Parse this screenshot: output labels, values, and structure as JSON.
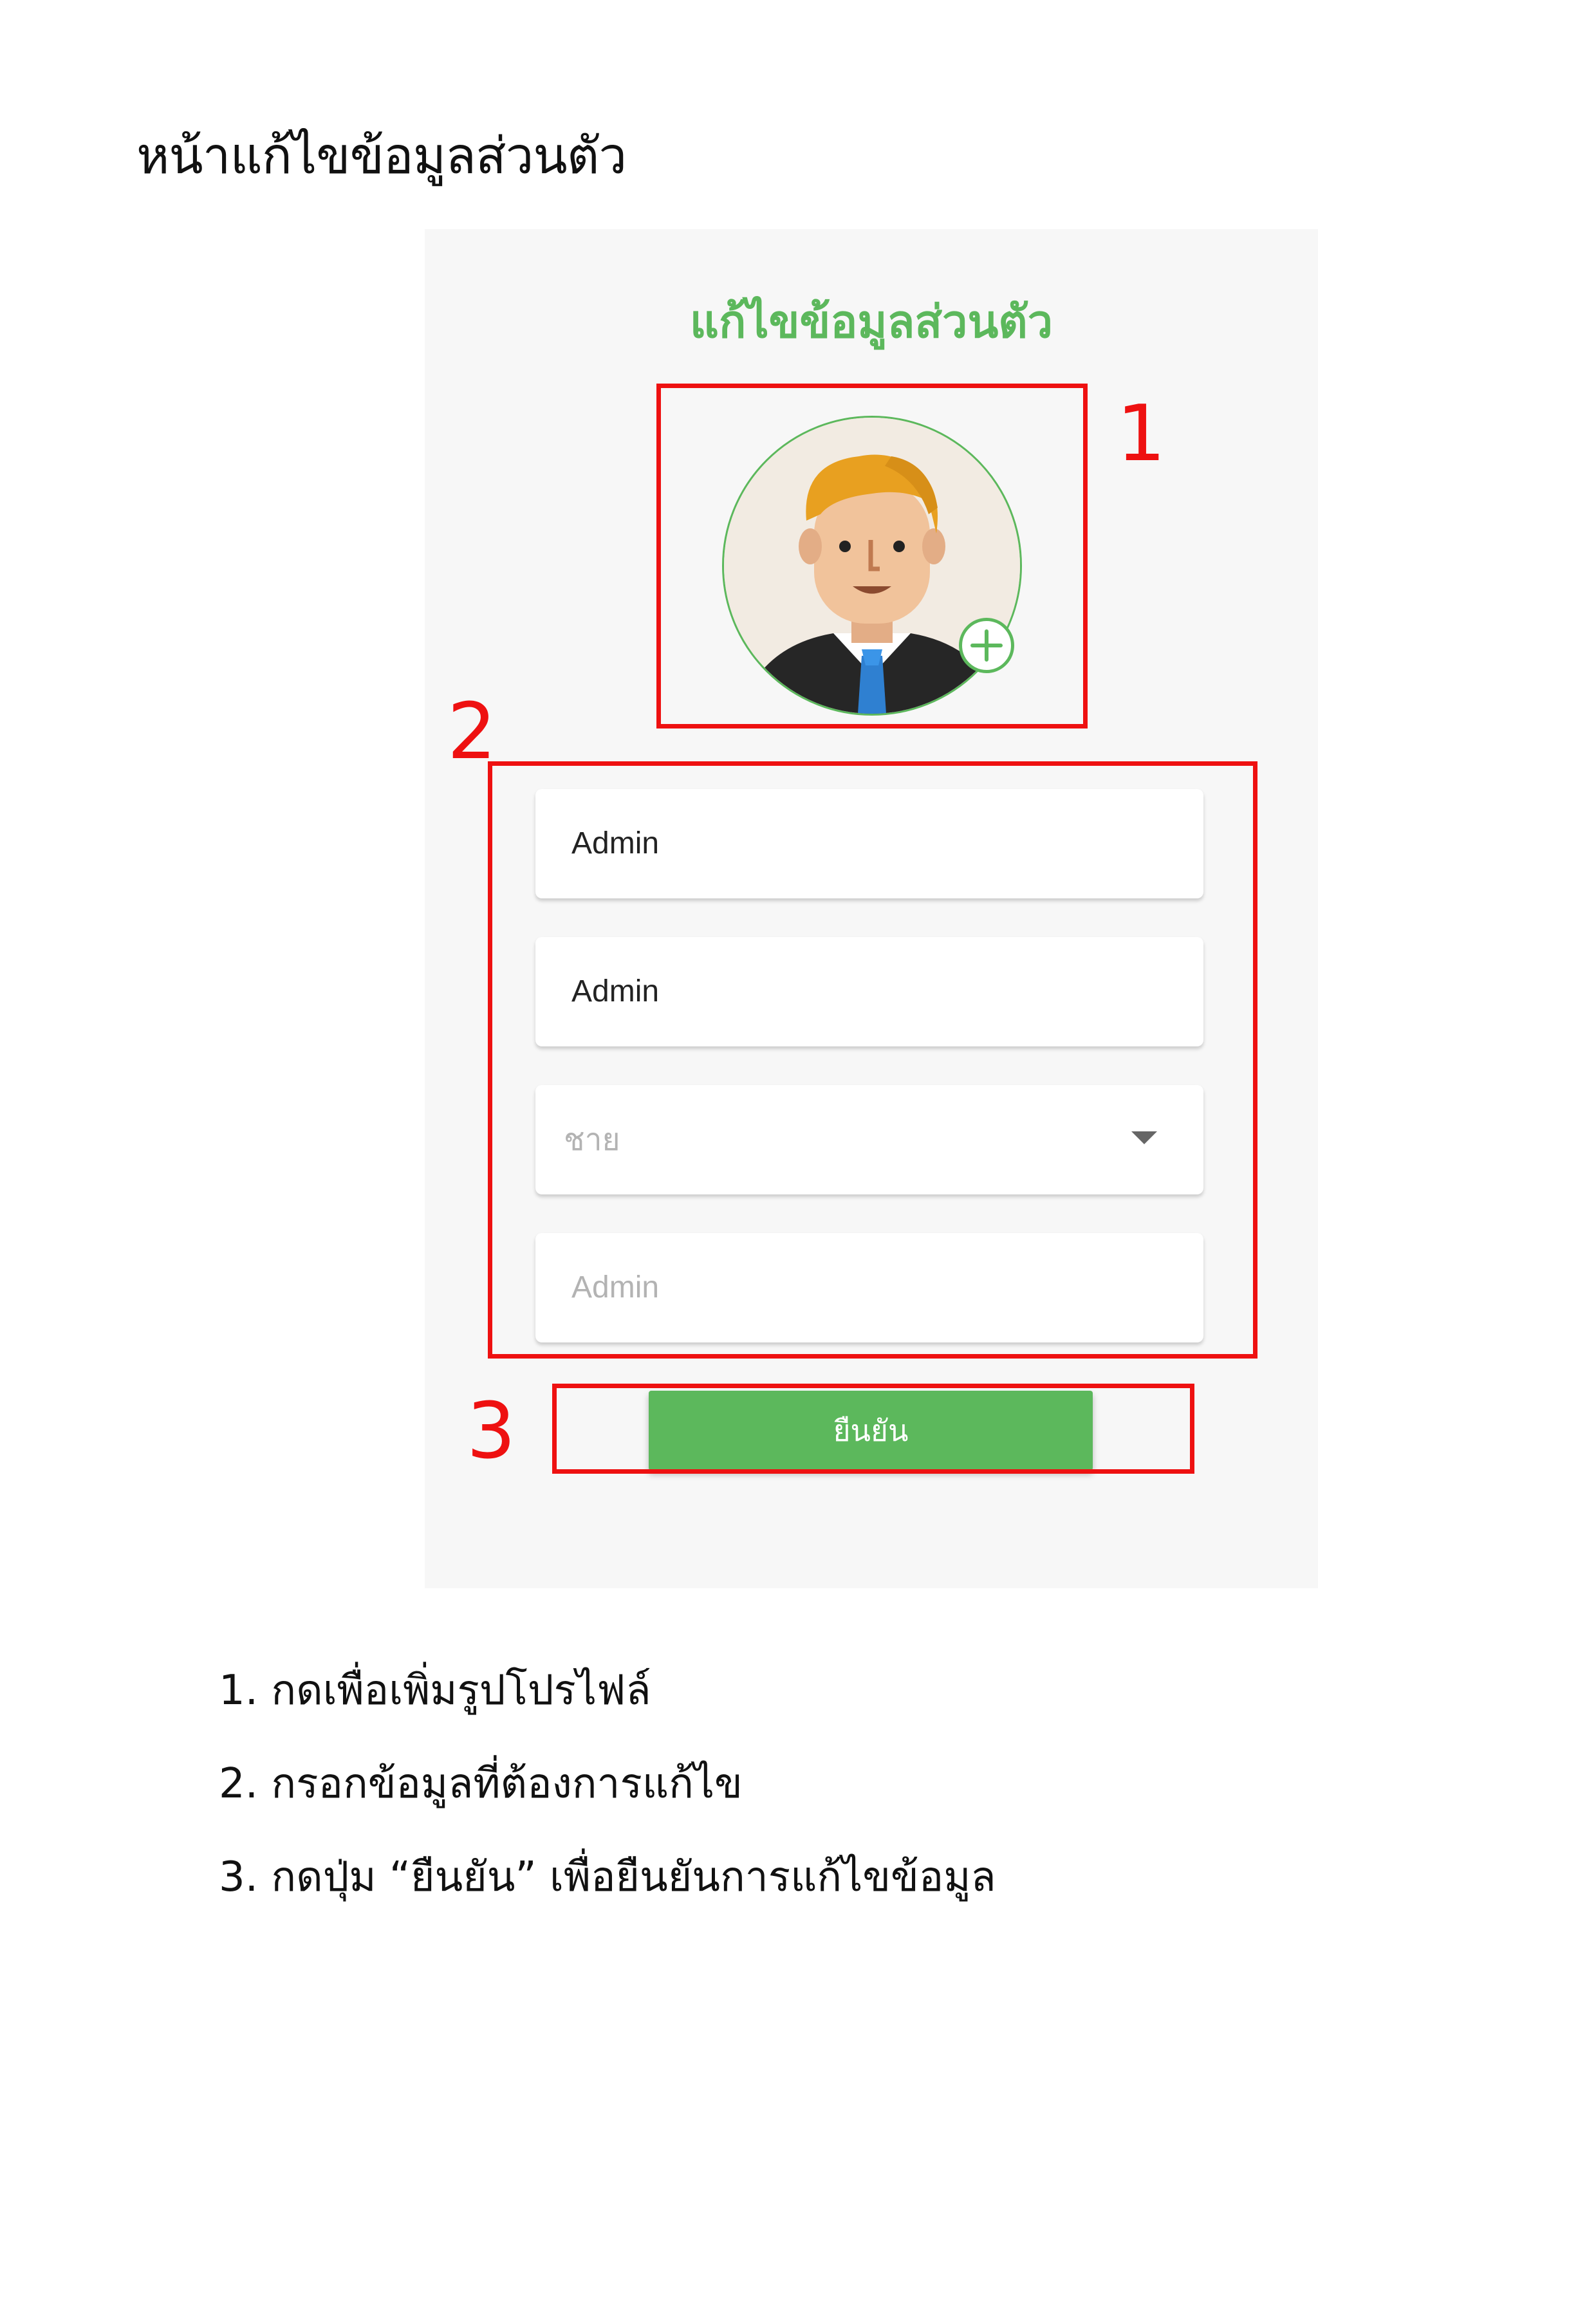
{
  "document": {
    "title": "หน้าแก้ไขข้อมูลส่วนตัว"
  },
  "screen": {
    "title": "แก้ไขข้อมูลส่วนตัว",
    "fields": [
      {
        "value": "Admin"
      },
      {
        "value": "Admin"
      },
      {
        "selected": "ชาย"
      },
      {
        "placeholder": "Admin"
      }
    ],
    "confirm_label": "ยืนยัน"
  },
  "markers": [
    "1",
    "2",
    "3"
  ],
  "notes": [
    "1. กดเพื่อเพิ่มรูปโปรไฟล์",
    "2. กรอกข้อมูลที่ต้องการแก้ไข",
    "3. กดปุ่ม “ยืนยัน” เพื่อยืนยันการแก้ไขข้อมูล"
  ],
  "colors": {
    "accent": "#5cb85c",
    "highlight": "#ee1111",
    "screen_bg": "#f7f7f7"
  },
  "icons": [
    "avatar-image",
    "add-photo-icon",
    "dropdown-arrow-icon"
  ]
}
